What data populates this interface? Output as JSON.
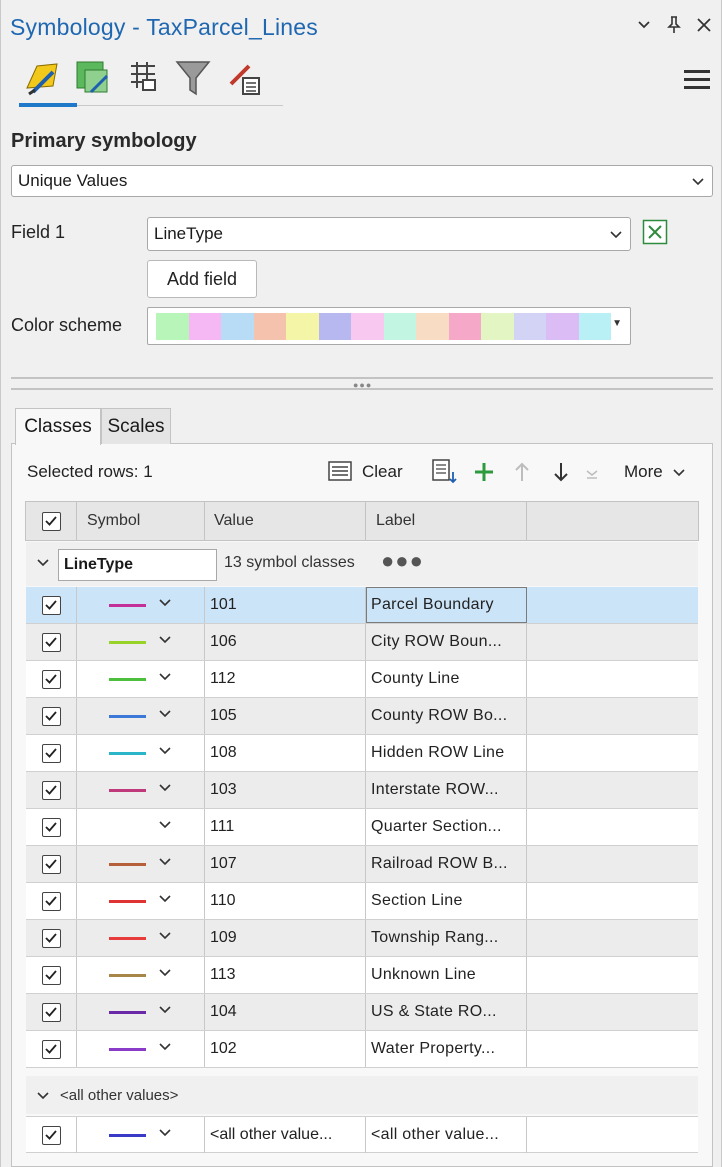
{
  "window": {
    "title": "Symbology - TaxParcel_Lines"
  },
  "ribbon": {
    "icons": [
      "primary-symbology-icon",
      "vary-symbology-icon",
      "symbol-layers-icon",
      "filter-icon",
      "symbol-properties-icon"
    ],
    "menu_icon": "hamburger-menu-icon"
  },
  "primary": {
    "title": "Primary symbology",
    "type_value": "Unique Values"
  },
  "field": {
    "label": "Field 1",
    "value": "LineType",
    "add_field_label": "Add field"
  },
  "color_scheme": {
    "label": "Color scheme",
    "swatches": [
      "#b8f5b8",
      "#f5b8f5",
      "#b8dcf5",
      "#f5c3ad",
      "#f5f5a8",
      "#b8b8f0",
      "#f8c8f0",
      "#c3f5e3",
      "#f8dcc3",
      "#f5a8c8",
      "#e3f5c3",
      "#d3d3f5",
      "#dcbcf5",
      "#b8f0f5"
    ]
  },
  "tabs": [
    {
      "label": "Classes"
    },
    {
      "label": "Scales"
    }
  ],
  "toolbar": {
    "selected_rows": "Selected rows: 1",
    "clear_label": "Clear",
    "more_label": "More"
  },
  "table": {
    "headers": {
      "symbol": "Symbol",
      "value": "Value",
      "label": "Label"
    },
    "group": {
      "field": "LineType",
      "count_text": "13 symbol classes",
      "dots": "●●●"
    },
    "rows": [
      {
        "value": "101",
        "label": "Parcel Boundary",
        "color": "#c4309a"
      },
      {
        "value": "106",
        "label": "City ROW Boun...",
        "color": "#98d32a"
      },
      {
        "value": "112",
        "label": "County Line",
        "color": "#4cbf3c"
      },
      {
        "value": "105",
        "label": "County ROW Bo...",
        "color": "#3c78d8"
      },
      {
        "value": "108",
        "label": "Hidden ROW Line",
        "color": "#2bb5c8"
      },
      {
        "value": "103",
        "label": "Interstate ROW...",
        "color": "#c0397a"
      },
      {
        "value": "111",
        "label": "Quarter Section...",
        "color": "#ffffff"
      },
      {
        "value": "107",
        "label": "Railroad ROW B...",
        "color": "#b5603a"
      },
      {
        "value": "110",
        "label": "Section Line",
        "color": "#e03434"
      },
      {
        "value": "109",
        "label": "Township Rang...",
        "color": "#e83b3b"
      },
      {
        "value": "113",
        "label": "Unknown Line",
        "color": "#a8864a"
      },
      {
        "value": "104",
        "label": "US & State RO...",
        "color": "#6a2aa8"
      },
      {
        "value": "102",
        "label": "Water Property...",
        "color": "#8a3cc8"
      }
    ],
    "other_header": "<all other values>",
    "other_row": {
      "value": "<all other value...",
      "label": "<all other value...",
      "color": "#3a3ac8"
    }
  }
}
